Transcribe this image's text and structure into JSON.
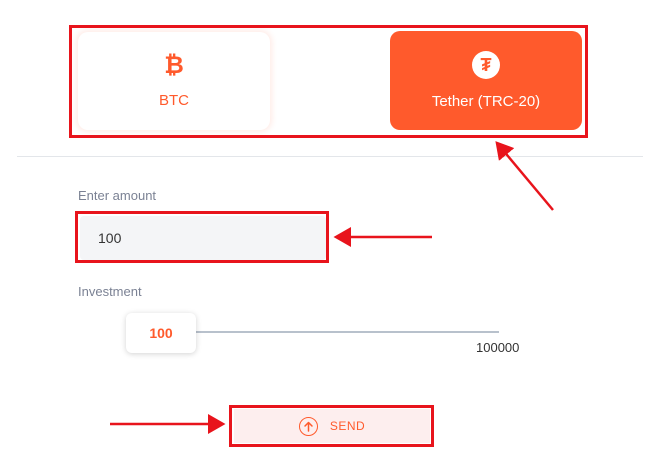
{
  "currencies": [
    {
      "id": "btc",
      "label": "BTC",
      "icon": "bitcoin-icon",
      "selected": false
    },
    {
      "id": "usdt",
      "label": "Tether (TRC-20)",
      "icon": "tether-icon",
      "selected": true
    }
  ],
  "amount": {
    "label": "Enter amount",
    "value": "100"
  },
  "investment": {
    "label": "Investment",
    "value": "100",
    "max_label": "100000",
    "level": 0
  },
  "send": {
    "label": "SEND",
    "icon": "arrow-up-circle-icon"
  },
  "colors": {
    "accent": "#ff5a2c",
    "annotation": "#e8141c"
  }
}
